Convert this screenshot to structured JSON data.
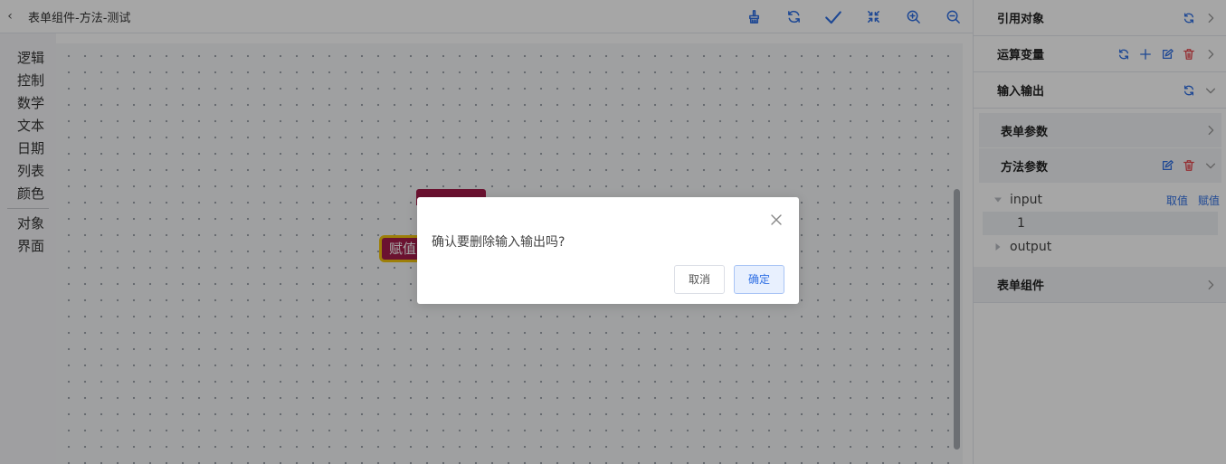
{
  "header": {
    "back_glyph": "‹",
    "title": "表单组件-方法-测试",
    "tools": [
      "brush-icon",
      "refresh-icon",
      "check-icon",
      "collapse-icon",
      "zoom-in-icon",
      "zoom-out-icon"
    ]
  },
  "categories": {
    "group1": [
      "逻辑",
      "控制",
      "数学",
      "文本",
      "日期",
      "列表",
      "颜色"
    ],
    "group2": [
      "对象",
      "界面"
    ]
  },
  "workspace": {
    "block_assign_label": "赋值",
    "block_color": "#a51d4b",
    "highlight_color": "#f1c40f"
  },
  "right_panel": {
    "ref_objects": "引用对象",
    "calc_vars": "运算变量",
    "io": "输入输出",
    "form_params": "表单参数",
    "method_params": "方法参数",
    "tree": {
      "input_label": "input",
      "get_value": "取值",
      "set_value": "赋值",
      "input_value": "1",
      "output_label": "output"
    },
    "form_components": "表单组件"
  },
  "dialog": {
    "message": "确认要删除输入输出吗?",
    "cancel": "取消",
    "confirm": "确定"
  },
  "colors": {
    "accent": "#2f6fe4",
    "danger": "#e5484d"
  }
}
